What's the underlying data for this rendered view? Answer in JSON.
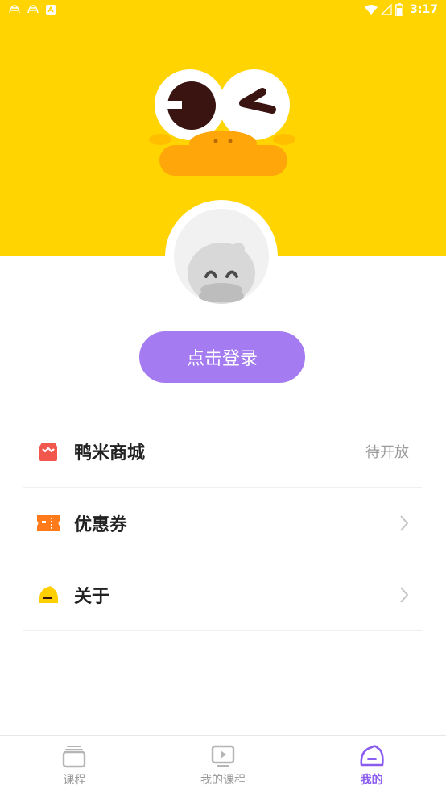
{
  "status_bar": {
    "time": "3:17",
    "left_icons": [
      "app-notification-icon",
      "app-notification-icon",
      "app-store-icon"
    ],
    "right_icons": [
      "wifi-icon",
      "signal-icon",
      "battery-icon"
    ]
  },
  "header": {
    "background_color": "#FFD400",
    "mascot": "duck-mascot-icon"
  },
  "profile": {
    "avatar": "default-duck-avatar-icon",
    "login_label": "点击登录",
    "login_color": "#A47BF1"
  },
  "menu": {
    "items": [
      {
        "label": "鸭米商城",
        "trail": "待开放",
        "icon": "shop-icon",
        "icon_color": "#F2574E"
      },
      {
        "label": "优惠券",
        "trail": "",
        "icon": "coupon-icon",
        "icon_color": "#FF7A1A"
      },
      {
        "label": "关于",
        "trail": "",
        "icon": "duck-head-icon",
        "icon_color": "#FFCF00"
      }
    ]
  },
  "tabbar": {
    "tabs": [
      {
        "label": "课程",
        "icon": "course-stack-icon",
        "active": false
      },
      {
        "label": "我的课程",
        "icon": "video-play-icon",
        "active": false
      },
      {
        "label": "我的",
        "icon": "duck-face-icon",
        "active": true
      }
    ],
    "active_color": "#8A5CF0"
  }
}
